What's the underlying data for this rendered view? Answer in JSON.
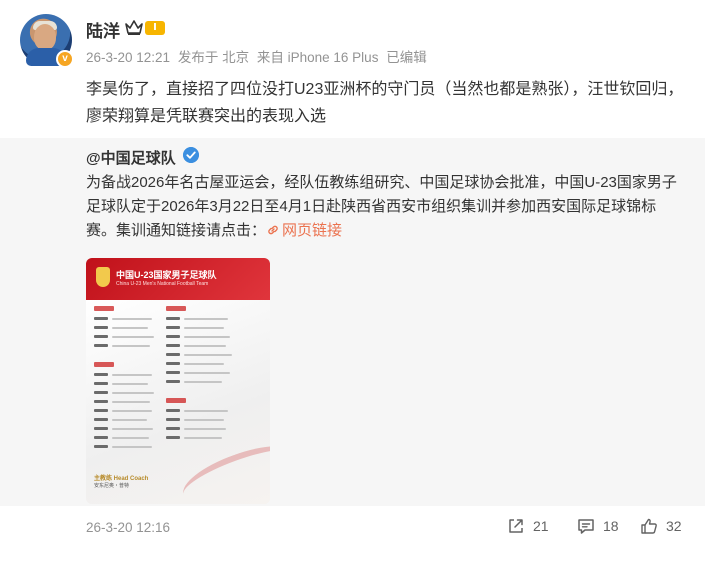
{
  "post": {
    "author": "陆洋",
    "level": "Ⅰ",
    "meta": {
      "time": "26-3-20 12:21",
      "published_from": "发布于 北京",
      "source": "来自 iPhone 16 Plus",
      "edited": "已编辑"
    },
    "text": "李昊伤了，直接招了四位没打U23亚洲杯的守门员（当然也都是熟张），汪世钦回归，廖荣翔算是凭联赛突出的表现入选"
  },
  "repost": {
    "author": "@中国足球队",
    "text": "为备战2026年名古屋亚运会，经队伍教练组研究、中国足球协会批准，中国U-23国家男子足球队定于2026年3月22日至4月1日赴陕西省西安市组织集训并参加西安国际足球锦标赛。集训通知链接请点击：",
    "link_label": "网页链接",
    "poster": {
      "title": "中国U-23国家男子足球队",
      "subtitle": "China U-23 Men's National Football Team",
      "coach_label": "主教练 Head Coach",
      "coach_name": "安东尼奥・普特"
    },
    "time": "26-3-20 12:16",
    "actions": {
      "reposts": "21",
      "comments": "18",
      "likes": "32"
    }
  },
  "colors": {
    "link": "#eb7350",
    "verified": "#3b8fe0",
    "level_badge": "#f7b500"
  },
  "icons": [
    "crown-icon",
    "verified-icon",
    "link-icon",
    "repost-icon",
    "comment-icon",
    "like-icon"
  ]
}
